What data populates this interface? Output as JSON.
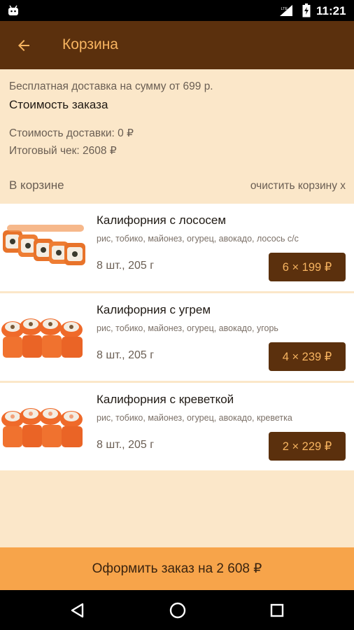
{
  "status_bar": {
    "time": "11:21"
  },
  "app_bar": {
    "title": "Корзина"
  },
  "summary": {
    "free_delivery": "Бесплатная доставка на сумму от 699 р.",
    "order_cost_label": "Стоимость заказа",
    "delivery_cost": "Стоимость доставки: 0 ₽",
    "total": "Итоговый чек: 2608 ₽"
  },
  "cart": {
    "header": "В корзине",
    "clear": "очистить корзину x",
    "items": [
      {
        "name": "Калифорния с лососем",
        "description": "рис, тобико, майонез, огурец, авокадо, лосось с/с",
        "quantity": "8 шт., 205 г",
        "price": "6 × 199 ₽"
      },
      {
        "name": "Калифорния с угрем",
        "description": "рис, тобико, майонез, огурец, авокадо, угорь",
        "quantity": "8 шт., 205 г",
        "price": "4 × 239 ₽"
      },
      {
        "name": "Калифорния с креветкой",
        "description": "рис, тобико, майонез, огурец, авокадо, креветка",
        "quantity": "8 шт., 205 г",
        "price": "2 × 229 ₽"
      }
    ]
  },
  "checkout": {
    "label": "Оформить заказ на 2 608 ₽"
  },
  "icons": {
    "status": [
      "android-icon",
      "signal-icon",
      "battery-icon"
    ],
    "app_bar": [
      "back-arrow-icon"
    ],
    "nav": [
      "back-triangle-icon",
      "home-circle-icon",
      "recents-square-icon"
    ]
  },
  "colors": {
    "app_bar": "#5b300d",
    "accent": "#f7b460",
    "background": "#fbe7c9",
    "checkout": "#f7a44a"
  }
}
